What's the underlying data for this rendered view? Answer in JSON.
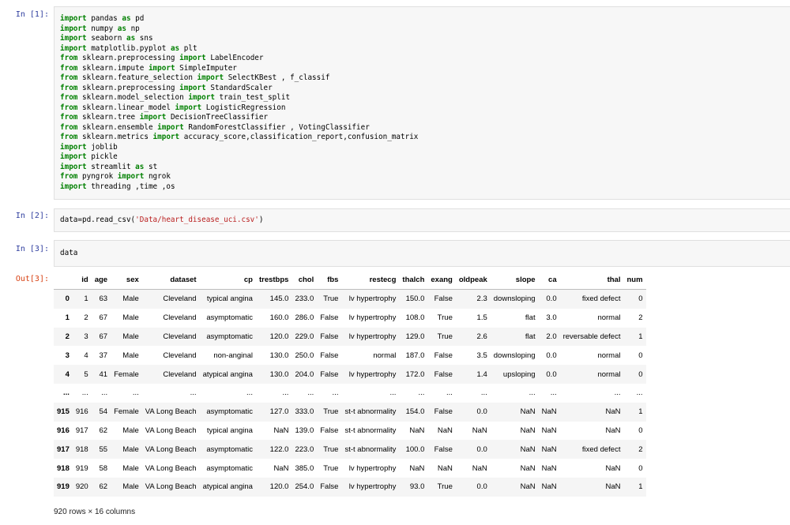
{
  "cells": {
    "in1": {
      "prompt": "In [1]:"
    },
    "in2": {
      "prompt": "In [2]:"
    },
    "in3": {
      "prompt": "In [3]:",
      "code": "data"
    },
    "out3": {
      "prompt": "Out[3]:"
    }
  },
  "code1_lines": [
    [
      {
        "k": "import"
      },
      {
        "t": " pandas "
      },
      {
        "k": "as"
      },
      {
        "t": " pd"
      }
    ],
    [
      {
        "k": "import"
      },
      {
        "t": " numpy "
      },
      {
        "k": "as"
      },
      {
        "t": " np"
      }
    ],
    [
      {
        "k": "import"
      },
      {
        "t": " seaborn "
      },
      {
        "k": "as"
      },
      {
        "t": " sns"
      }
    ],
    [
      {
        "k": "import"
      },
      {
        "t": " matplotlib.pyplot "
      },
      {
        "k": "as"
      },
      {
        "t": " plt"
      }
    ],
    [
      {
        "k": "from"
      },
      {
        "t": " sklearn.preprocessing "
      },
      {
        "k": "import"
      },
      {
        "t": " LabelEncoder"
      }
    ],
    [
      {
        "k": "from"
      },
      {
        "t": " sklearn.impute "
      },
      {
        "k": "import"
      },
      {
        "t": " SimpleImputer"
      }
    ],
    [
      {
        "k": "from"
      },
      {
        "t": " sklearn.feature_selection "
      },
      {
        "k": "import"
      },
      {
        "t": " SelectKBest , f_classif"
      }
    ],
    [
      {
        "k": "from"
      },
      {
        "t": " sklearn.preprocessing "
      },
      {
        "k": "import"
      },
      {
        "t": " StandardScaler"
      }
    ],
    [
      {
        "k": "from"
      },
      {
        "t": " sklearn.model_selection "
      },
      {
        "k": "import"
      },
      {
        "t": " train_test_split"
      }
    ],
    [
      {
        "k": "from"
      },
      {
        "t": " sklearn.linear_model "
      },
      {
        "k": "import"
      },
      {
        "t": " LogisticRegression"
      }
    ],
    [
      {
        "k": "from"
      },
      {
        "t": " sklearn.tree "
      },
      {
        "k": "import"
      },
      {
        "t": " DecisionTreeClassifier"
      }
    ],
    [
      {
        "k": "from"
      },
      {
        "t": " sklearn.ensemble "
      },
      {
        "k": "import"
      },
      {
        "t": " RandomForestClassifier , VotingClassifier"
      }
    ],
    [
      {
        "k": "from"
      },
      {
        "t": " sklearn.metrics "
      },
      {
        "k": "import"
      },
      {
        "t": " accuracy_score,classification_report,confusion_matrix"
      }
    ],
    [
      {
        "k": "import"
      },
      {
        "t": " joblib"
      }
    ],
    [
      {
        "k": "import"
      },
      {
        "t": " pickle"
      }
    ],
    [
      {
        "k": "import"
      },
      {
        "t": " streamlit "
      },
      {
        "k": "as"
      },
      {
        "t": " st"
      }
    ],
    [
      {
        "k": "from"
      },
      {
        "t": " pyngrok "
      },
      {
        "k": "import"
      },
      {
        "t": " ngrok"
      }
    ],
    [
      {
        "k": "import"
      },
      {
        "t": " threading ,time ,os"
      }
    ]
  ],
  "code2_parts": [
    {
      "t": "data=pd.read_csv("
    },
    {
      "s": "'Data/heart_disease_uci.csv'"
    },
    {
      "t": ")"
    }
  ],
  "dataframe": {
    "columns": [
      "",
      "id",
      "age",
      "sex",
      "dataset",
      "cp",
      "trestbps",
      "chol",
      "fbs",
      "restecg",
      "thalch",
      "exang",
      "oldpeak",
      "slope",
      "ca",
      "thal",
      "num"
    ],
    "rows": [
      [
        "0",
        "1",
        "63",
        "Male",
        "Cleveland",
        "typical angina",
        "145.0",
        "233.0",
        "True",
        "lv hypertrophy",
        "150.0",
        "False",
        "2.3",
        "downsloping",
        "0.0",
        "fixed defect",
        "0"
      ],
      [
        "1",
        "2",
        "67",
        "Male",
        "Cleveland",
        "asymptomatic",
        "160.0",
        "286.0",
        "False",
        "lv hypertrophy",
        "108.0",
        "True",
        "1.5",
        "flat",
        "3.0",
        "normal",
        "2"
      ],
      [
        "2",
        "3",
        "67",
        "Male",
        "Cleveland",
        "asymptomatic",
        "120.0",
        "229.0",
        "False",
        "lv hypertrophy",
        "129.0",
        "True",
        "2.6",
        "flat",
        "2.0",
        "reversable defect",
        "1"
      ],
      [
        "3",
        "4",
        "37",
        "Male",
        "Cleveland",
        "non-anginal",
        "130.0",
        "250.0",
        "False",
        "normal",
        "187.0",
        "False",
        "3.5",
        "downsloping",
        "0.0",
        "normal",
        "0"
      ],
      [
        "4",
        "5",
        "41",
        "Female",
        "Cleveland",
        "atypical angina",
        "130.0",
        "204.0",
        "False",
        "lv hypertrophy",
        "172.0",
        "False",
        "1.4",
        "upsloping",
        "0.0",
        "normal",
        "0"
      ],
      [
        "...",
        "...",
        "...",
        "...",
        "...",
        "...",
        "...",
        "...",
        "...",
        "...",
        "...",
        "...",
        "...",
        "...",
        "...",
        "...",
        "..."
      ],
      [
        "915",
        "916",
        "54",
        "Female",
        "VA Long Beach",
        "asymptomatic",
        "127.0",
        "333.0",
        "True",
        "st-t abnormality",
        "154.0",
        "False",
        "0.0",
        "NaN",
        "NaN",
        "NaN",
        "1"
      ],
      [
        "916",
        "917",
        "62",
        "Male",
        "VA Long Beach",
        "typical angina",
        "NaN",
        "139.0",
        "False",
        "st-t abnormality",
        "NaN",
        "NaN",
        "NaN",
        "NaN",
        "NaN",
        "NaN",
        "0"
      ],
      [
        "917",
        "918",
        "55",
        "Male",
        "VA Long Beach",
        "asymptomatic",
        "122.0",
        "223.0",
        "True",
        "st-t abnormality",
        "100.0",
        "False",
        "0.0",
        "NaN",
        "NaN",
        "fixed defect",
        "2"
      ],
      [
        "918",
        "919",
        "58",
        "Male",
        "VA Long Beach",
        "asymptomatic",
        "NaN",
        "385.0",
        "True",
        "lv hypertrophy",
        "NaN",
        "NaN",
        "NaN",
        "NaN",
        "NaN",
        "NaN",
        "0"
      ],
      [
        "919",
        "920",
        "62",
        "Male",
        "VA Long Beach",
        "atypical angina",
        "120.0",
        "254.0",
        "False",
        "lv hypertrophy",
        "93.0",
        "True",
        "0.0",
        "NaN",
        "NaN",
        "NaN",
        "1"
      ]
    ],
    "shape": "920 rows × 16 columns"
  }
}
